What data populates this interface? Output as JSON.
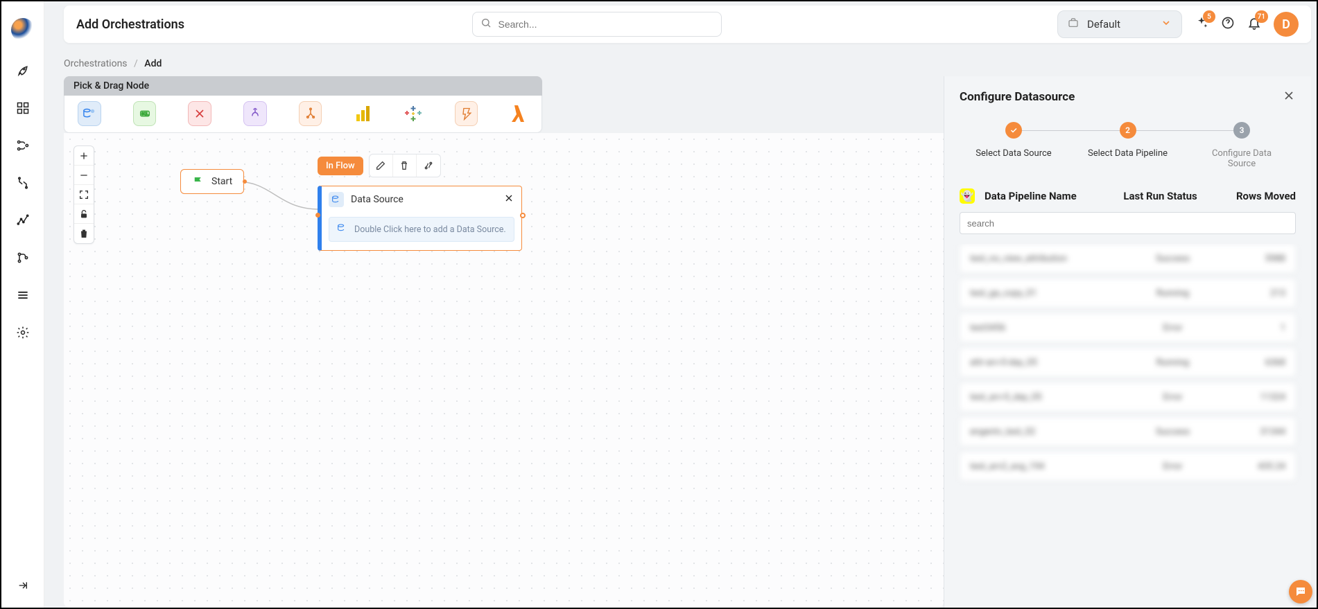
{
  "header": {
    "title": "Add Orchestrations",
    "search_placeholder": "Search...",
    "selector_label": "Default",
    "sparkle_badge": "5",
    "bell_badge": "71",
    "avatar_initial": "D"
  },
  "breadcrumb": {
    "root": "Orchestrations",
    "current": "Add"
  },
  "palette": {
    "header": "Pick & Drag Node"
  },
  "canvas": {
    "start_label": "Start",
    "ds_title": "Data Source",
    "ds_placeholder": "Double Click here to add a Data Source.",
    "tag": "In Flow"
  },
  "panel": {
    "title": "Configure Datasource",
    "step1": "Select Data Source",
    "step2": "Select Data Pipeline",
    "step3": "Configure Data Source",
    "step2_num": "2",
    "step3_num": "3",
    "col1": "Data Pipeline Name",
    "col2": "Last Run Status",
    "col3": "Rows Moved",
    "search_placeholder": "search",
    "rows": [
      {
        "name": "test_no_view_attribution",
        "status": "Success",
        "rows": "5988"
      },
      {
        "name": "test_ga_copy_01",
        "status": "Running",
        "rows": "213"
      },
      {
        "name": "test3456",
        "status": "Error",
        "rows": "1"
      },
      {
        "name": "attr-arv-0-day_05",
        "status": "Running",
        "rows": "6368"
      },
      {
        "name": "test_arv-0_day_05",
        "status": "Error",
        "rows": "11324"
      },
      {
        "name": "engentv_test_02",
        "status": "Success",
        "rows": "31344"
      },
      {
        "name": "test_arv2_avg_194",
        "status": "Error",
        "rows": "435.24"
      }
    ]
  }
}
